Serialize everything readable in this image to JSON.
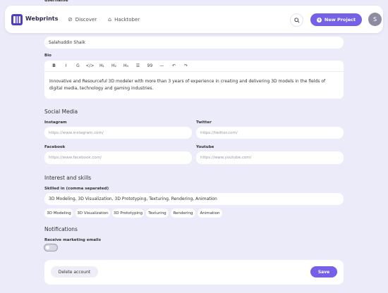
{
  "form_top_label": "username",
  "name_label": "Full name",
  "header": {
    "brand": "Webprints",
    "nav": [
      {
        "label": "Discover",
        "icon": "compass-icon"
      },
      {
        "label": "Hacktober",
        "icon": "bag-icon"
      }
    ],
    "new_project_label": "New Project",
    "avatar_initial": "S",
    "accent": "#7560e8"
  },
  "profile": {
    "name_value": "Salahuddin Shaik",
    "bio_label": "Bio",
    "bio_toolbar": [
      "B",
      "I",
      "G",
      "</>",
      "H₁",
      "H₂",
      "H₃",
      "☰",
      "99",
      "—",
      "↶",
      "↷"
    ],
    "bio_text": "Innovative and Resourceful 3D modeler with more than 3 years of experience in creating and delivering 3D models in the fields of digital media, technology and gaming industries."
  },
  "social": {
    "title": "Social Media",
    "instagram_label": "Instagram",
    "instagram_placeholder": "https://www.instagram.com/",
    "twitter_label": "Twitter",
    "twitter_placeholder": "https://twitter.com/",
    "facebook_label": "Facebook",
    "facebook_placeholder": "https://www.facebook.com/",
    "youtube_label": "Youtube",
    "youtube_placeholder": "https://www.youtube.com/"
  },
  "skills": {
    "title": "Interest and skills",
    "label": "Skilled in (comma separated)",
    "value": "3D Modeling, 3D Visualization, 3D Prototyping, Texturing, Rendering, Animation",
    "chips": [
      "3D Modeling",
      "3D Visualization",
      "3D Prototyping",
      "Texturing",
      "Rendering",
      "Animation"
    ]
  },
  "notifications": {
    "title": "Notifications",
    "marketing_label": "Receive marketing emails",
    "marketing_enabled": false
  },
  "actions": {
    "delete_label": "Delete account",
    "save_label": "Save"
  }
}
